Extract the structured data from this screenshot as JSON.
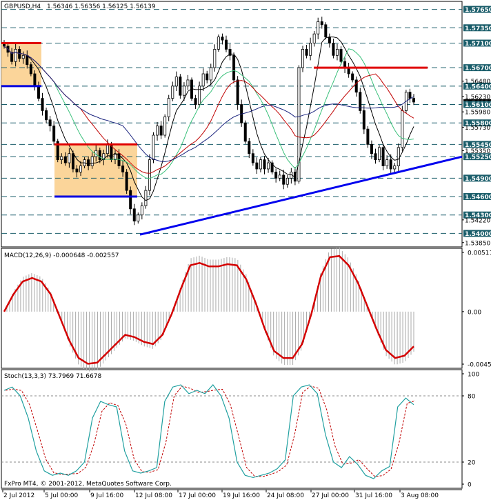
{
  "header": {
    "symbol_tf": "GBPUSD,H4",
    "ohlc": "1.56346 1.56356 1.56125 1.56139"
  },
  "macd": {
    "label": "MACD(12,26,9) -0.000648 -0.002557"
  },
  "stoch": {
    "label": "Stoch(13,3,3) 73.7969 71.6678"
  },
  "footer": {
    "copyright": "FxPro MT4, © 2001-2012, MetaQuotes Software Corp."
  },
  "chart_data": {
    "type": "candlestick",
    "price_axis": {
      "top": 1.5778,
      "bottom": 1.5378,
      "ticks": [
        "1.56480",
        "1.56230",
        "1.55980",
        "1.55730",
        "1.55350",
        "1.54220",
        "1.53850"
      ],
      "boxed": [
        {
          "value": 1.5765,
          "label": "1.57650"
        },
        {
          "value": 1.5735,
          "label": "1.57350"
        },
        {
          "value": 1.571,
          "label": "1.57100"
        },
        {
          "value": 1.567,
          "label": "1.56700"
        },
        {
          "value": 1.564,
          "label": "1.56400"
        },
        {
          "value": 1.5613,
          "label": "1.56139"
        },
        {
          "value": 1.561,
          "label": "1.56100"
        },
        {
          "value": 1.558,
          "label": "1.55800"
        },
        {
          "value": 1.5545,
          "label": "1.55450"
        },
        {
          "value": 1.5525,
          "label": "1.55250"
        },
        {
          "value": 1.549,
          "label": "1.54900"
        },
        {
          "value": 1.546,
          "label": "1.54600"
        },
        {
          "value": 1.543,
          "label": "1.54300"
        },
        {
          "value": 1.54,
          "label": "1.54000"
        }
      ],
      "plain_tick_values": [
        1.5648,
        1.5623,
        1.5598,
        1.5573,
        1.5535,
        1.5422,
        1.5385
      ]
    },
    "x_labels": [
      "2 Jul 2012",
      "5 Jul 00:00",
      "9 Jul 16:00",
      "12 Jul 08:00",
      "17 Jul 00:00",
      "19 Jul 16:00",
      "24 Jul 08:00",
      "27 Jul 00:00",
      "31 Jul 16:00",
      "3 Aug 08:00"
    ],
    "close_series": [
      1.5705,
      1.5695,
      1.568,
      1.57,
      1.5685,
      1.569,
      1.5675,
      1.566,
      1.564,
      1.562,
      1.56,
      1.5585,
      1.5575,
      1.555,
      1.552,
      1.5525,
      1.5515,
      1.553,
      1.5505,
      1.55,
      1.551,
      1.552,
      1.551,
      1.5525,
      1.5535,
      1.552,
      1.553,
      1.5545,
      1.552,
      1.553,
      1.551,
      1.55,
      1.547,
      1.544,
      1.542,
      1.543,
      1.5445,
      1.547,
      1.552,
      1.556,
      1.5575,
      1.556,
      1.559,
      1.562,
      1.564,
      1.5655,
      1.5625,
      1.564,
      1.565,
      1.562,
      1.561,
      1.564,
      1.566,
      1.565,
      1.567,
      1.57,
      1.572,
      1.5715,
      1.57,
      1.569,
      1.565,
      1.561,
      1.558,
      1.555,
      1.553,
      1.5515,
      1.5505,
      1.552,
      1.5505,
      1.5515,
      1.55,
      1.549,
      1.5495,
      1.548,
      1.549,
      1.55,
      1.5485,
      1.567,
      1.57,
      1.569,
      1.571,
      1.5725,
      1.5745,
      1.574,
      1.572,
      1.571,
      1.569,
      1.57,
      1.568,
      1.567,
      1.566,
      1.565,
      1.563,
      1.56,
      1.557,
      1.5545,
      1.553,
      1.552,
      1.554,
      1.551,
      1.552,
      1.5505,
      1.551,
      1.554,
      1.56,
      1.563,
      1.562,
      1.5614
    ],
    "drawn_objects": {
      "red_levels": [
        1.571,
        1.5545,
        1.567
      ],
      "blue_levels": [
        1.564,
        1.546
      ],
      "trendline": {
        "from": 1.5398,
        "to": 1.5525
      }
    },
    "macd": {
      "ticks": [
        "0.00511",
        "0.00",
        "-0.00453"
      ],
      "values": [
        0.00511,
        0.0,
        -0.00453
      ],
      "signal_shape": [
        0.0,
        0.0015,
        0.0026,
        0.0029,
        0.0026,
        0.0015,
        -0.0005,
        -0.0025,
        -0.004,
        -0.0045,
        -0.0044,
        -0.0036,
        -0.0028,
        -0.002,
        -0.0022,
        -0.0026,
        -0.0028,
        -0.002,
        -0.0002,
        0.002,
        0.004,
        0.0042,
        0.0039,
        0.0039,
        0.0041,
        0.004,
        0.0028,
        0.0008,
        -0.0015,
        -0.0034,
        -0.004,
        -0.004,
        -0.0028,
        -0.0002,
        0.003,
        0.0047,
        0.0048,
        0.004,
        0.0025,
        0.0005,
        -0.0015,
        -0.0033,
        -0.004,
        -0.0038,
        -0.003
      ]
    },
    "stoch": {
      "ticks": [
        "100",
        "80",
        "20",
        "0"
      ],
      "values": [
        100,
        80,
        20,
        0
      ],
      "main_shape": [
        85,
        88,
        80,
        60,
        30,
        12,
        8,
        10,
        8,
        12,
        20,
        60,
        75,
        72,
        70,
        30,
        12,
        10,
        12,
        15,
        75,
        88,
        90,
        82,
        85,
        82,
        90,
        80,
        60,
        20,
        8,
        6,
        8,
        10,
        14,
        22,
        80,
        88,
        90,
        82,
        45,
        20,
        15,
        25,
        18,
        8,
        5,
        12,
        16,
        70,
        78,
        72
      ]
    }
  }
}
